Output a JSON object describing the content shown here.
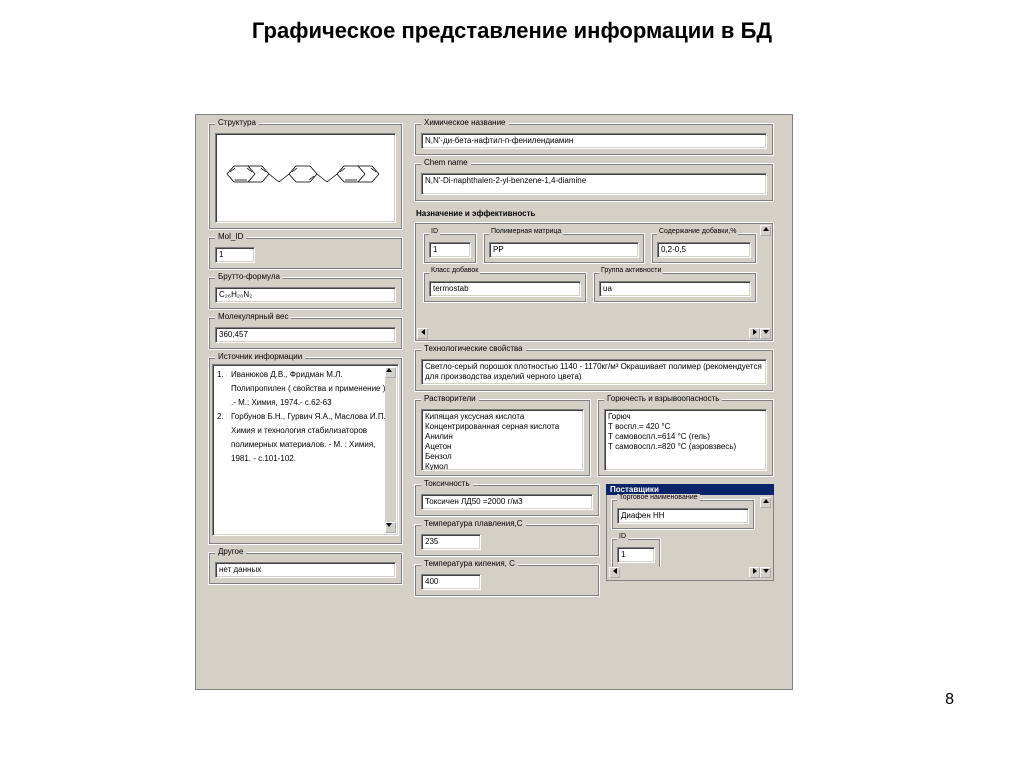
{
  "slide": {
    "title": "Графическое представление информации в БД",
    "page_number": "8"
  },
  "left": {
    "structure_label": "Структура",
    "mol_id_label": "Mol_ID",
    "mol_id_value": "1",
    "formula_label": "Брутто-формула",
    "formula_value": "C₂₆H₂₀N₂",
    "mw_label": "Молекулярный вес",
    "mw_value": "360,457",
    "source_label": "Источник информации",
    "source_items": [
      {
        "n": "1.",
        "text": "Иванюков Д.В., Фридман М.Л. Полипропилен ( свойства и применение ) .- М.: Химия, 1974.- с.62-63"
      },
      {
        "n": "2.",
        "text": "Горбунов Б.Н., Гурвич Я.А., Маслова И.П. Химия и технология стабилизаторов полимерных материалов. - М. : Химия, 1981. - с.101-102."
      }
    ],
    "other_label": "Другое",
    "other_value": "нет данных"
  },
  "right": {
    "chem_ru_label": "Химическое название",
    "chem_ru_value": "N,N'-ди-бета-нафтил-п-фенилендиамин",
    "chem_en_label": "Chem name",
    "chem_en_value": "N,N'-Di-naphthalen-2-yl-benzene-1,4-diamine",
    "purpose_label": "Назначение и эффективность",
    "id_label": "ID",
    "id_value": "1",
    "matrix_label": "Полимерная матрица",
    "matrix_value": "PP",
    "additive_label": "Содержание добавки,%",
    "additive_value": "0,2-0,5",
    "class_label": "Класс добавок",
    "class_value": "termostab",
    "group_label": "Группа активности",
    "group_value": "ua",
    "tech_label": "Технологические свойства",
    "tech_value": "Светло-серый порошок плотностью 1140 - 1170кг/м³ Окрашивает полимер (рекомендуется для производства изделий черного цвета)",
    "solvents_label": "Растворители",
    "solvents_value": "Кипящая уксусная кислота\nКонцентрированная серная кислота\nАнилин\nАцетон\nБензол\nКумол",
    "fire_label": "Горючесть и взрывоопасность",
    "fire_value": "Горюч\nТ воспл.= 420 °C\nТ самовоспл.=614 °C (гель)\nТ самовоспл.=820 °C (аэровзвесь)",
    "tox_label": "Токсичность",
    "tox_value": "Токсичен ЛД50 =2000 г/м3",
    "mp_label": "Температура плавления,С",
    "mp_value": "235",
    "bp_label": "Температура кипения, С",
    "bp_value": "400",
    "suppliers_label": "Поставщики",
    "tradename_label": "Торговое наименование",
    "tradename_value": "Диафен НН",
    "sup_id_label": "ID",
    "sup_id_value": "1"
  }
}
